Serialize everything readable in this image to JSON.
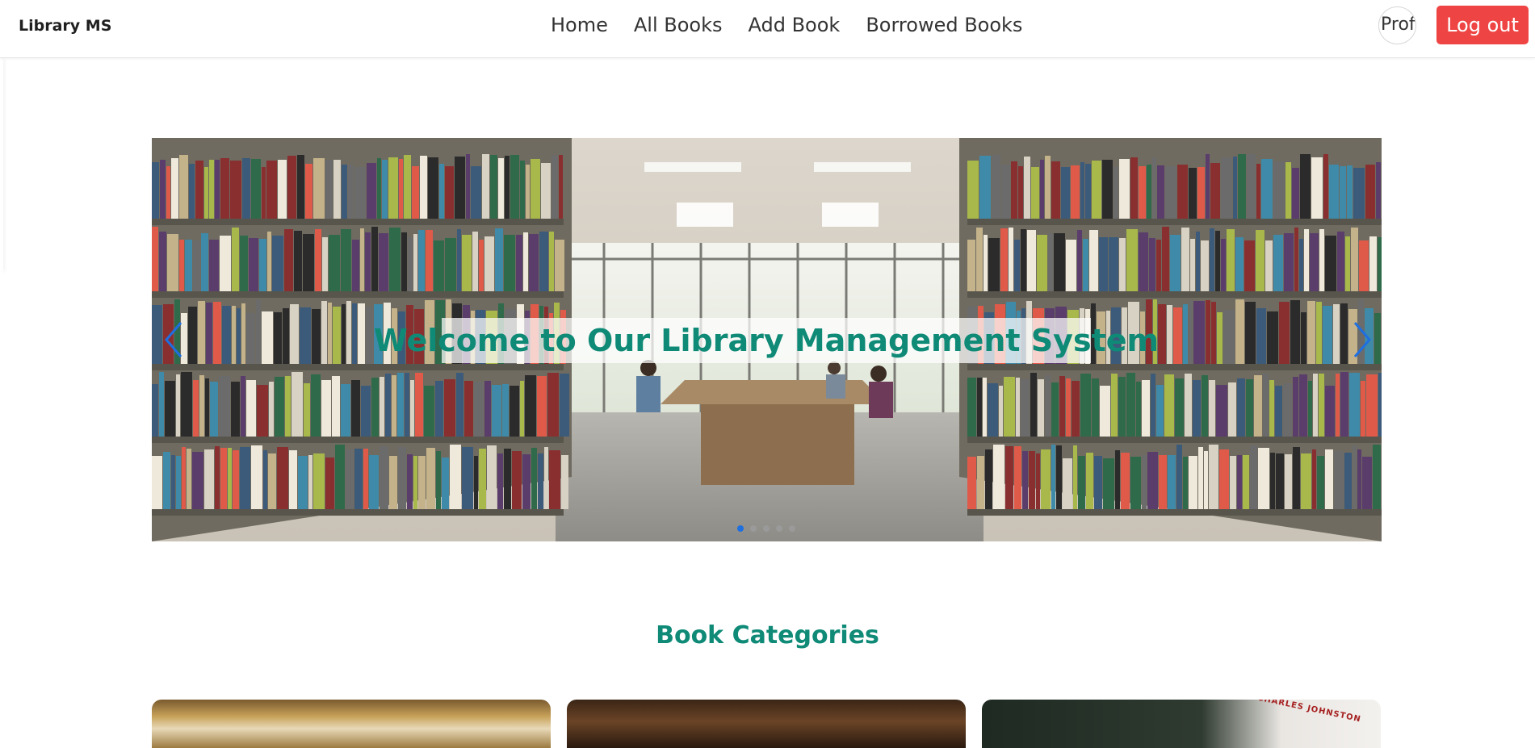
{
  "navbar": {
    "brand": "Library MS",
    "links": [
      {
        "label": "Home"
      },
      {
        "label": "All Books"
      },
      {
        "label": "Add Book"
      },
      {
        "label": "Borrowed Books"
      }
    ],
    "profile_label": "Profile",
    "logout_label": "Log out"
  },
  "carousel": {
    "caption": "Welcome to Our Library Management System",
    "slide_count": 5,
    "active_slide": 1,
    "prev_icon": "chevron-left-icon",
    "next_icon": "chevron-right-icon"
  },
  "categories": {
    "title": "Book Categories",
    "cards": [
      {
        "image_text": ""
      },
      {
        "image_text": ""
      },
      {
        "image_text": "CHARLES JOHNSTON"
      }
    ]
  },
  "colors": {
    "accent_teal": "#0e8a77",
    "logout_red": "#ef4444",
    "carousel_arrow_blue": "#1e6fe0"
  }
}
